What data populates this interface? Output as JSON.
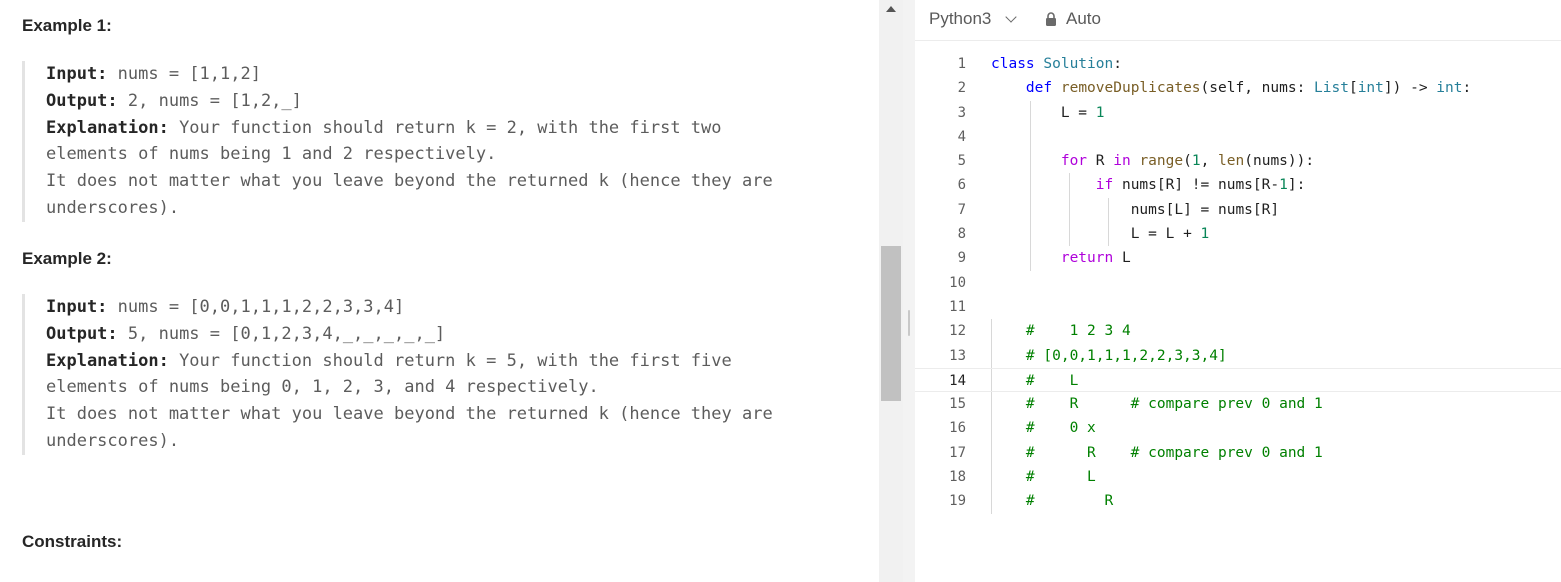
{
  "description": {
    "example1": {
      "title": "Example 1:",
      "input_label": "Input:",
      "input_value": " nums = [1,1,2]",
      "output_label": "Output:",
      "output_value": " 2, nums = [1,2,_]",
      "explanation_label": "Explanation:",
      "explanation_line1": " Your function should return k = 2, with the first two",
      "explanation_line2": "elements of nums being 1 and 2 respectively.",
      "explanation_line3": "It does not matter what you leave beyond the returned k (hence they are",
      "explanation_line4": "underscores)."
    },
    "example2": {
      "title": "Example 2:",
      "input_label": "Input:",
      "input_value": " nums = [0,0,1,1,1,2,2,3,3,4]",
      "output_label": "Output:",
      "output_value": " 5, nums = [0,1,2,3,4,_,_,_,_,_]",
      "explanation_label": "Explanation:",
      "explanation_line1": " Your function should return k = 5, with the first five",
      "explanation_line2": "elements of nums being 0, 1, 2, 3, and 4 respectively.",
      "explanation_line3": "It does not matter what you leave beyond the returned k (hence they are",
      "explanation_line4": "underscores)."
    },
    "constraints_title": "Constraints:"
  },
  "editor": {
    "language": "Python3",
    "mode": "Auto",
    "active_line": 14,
    "lines": [
      {
        "n": "1"
      },
      {
        "n": "2"
      },
      {
        "n": "3"
      },
      {
        "n": "4"
      },
      {
        "n": "5"
      },
      {
        "n": "6"
      },
      {
        "n": "7"
      },
      {
        "n": "8"
      },
      {
        "n": "9"
      },
      {
        "n": "10"
      },
      {
        "n": "11"
      },
      {
        "n": "12"
      },
      {
        "n": "13"
      },
      {
        "n": "14"
      },
      {
        "n": "15"
      },
      {
        "n": "16"
      },
      {
        "n": "17"
      },
      {
        "n": "18"
      },
      {
        "n": "19"
      }
    ],
    "code": {
      "l1_kw": "class",
      "l1_name": "Solution",
      "l1_tail": ":",
      "l2_kw": "def",
      "l2_fn": "removeDuplicates",
      "l2_a": "(self, nums: ",
      "l2_list": "List",
      "l2_b": "[",
      "l2_int": "int",
      "l2_c": "]) -> ",
      "l2_int2": "int",
      "l2_d": ":",
      "l3_a": "L = ",
      "l3_num": "1",
      "l5_for": "for",
      "l5_a": " R ",
      "l5_in": "in",
      "l5_b": " ",
      "l5_range": "range",
      "l5_c": "(",
      "l5_num": "1",
      "l5_d": ", ",
      "l5_len": "len",
      "l5_e": "(nums)):",
      "l6_if": "if",
      "l6_a": " nums[R] != nums[R-",
      "l6_num": "1",
      "l6_b": "]:",
      "l7": "nums[L] = nums[R]",
      "l8_a": "L = L + ",
      "l8_num": "1",
      "l9_ret": "return",
      "l9_a": " L",
      "l12": "#    1 2 3 4",
      "l13": "# [0,0,1,1,1,2,2,3,3,4]",
      "l14": "#    L",
      "l15": "#    R      # compare prev 0 and 1",
      "l16": "#    0 x",
      "l17": "#      R    # compare prev 0 and 1",
      "l18": "#      L",
      "l19": "#        R"
    }
  }
}
